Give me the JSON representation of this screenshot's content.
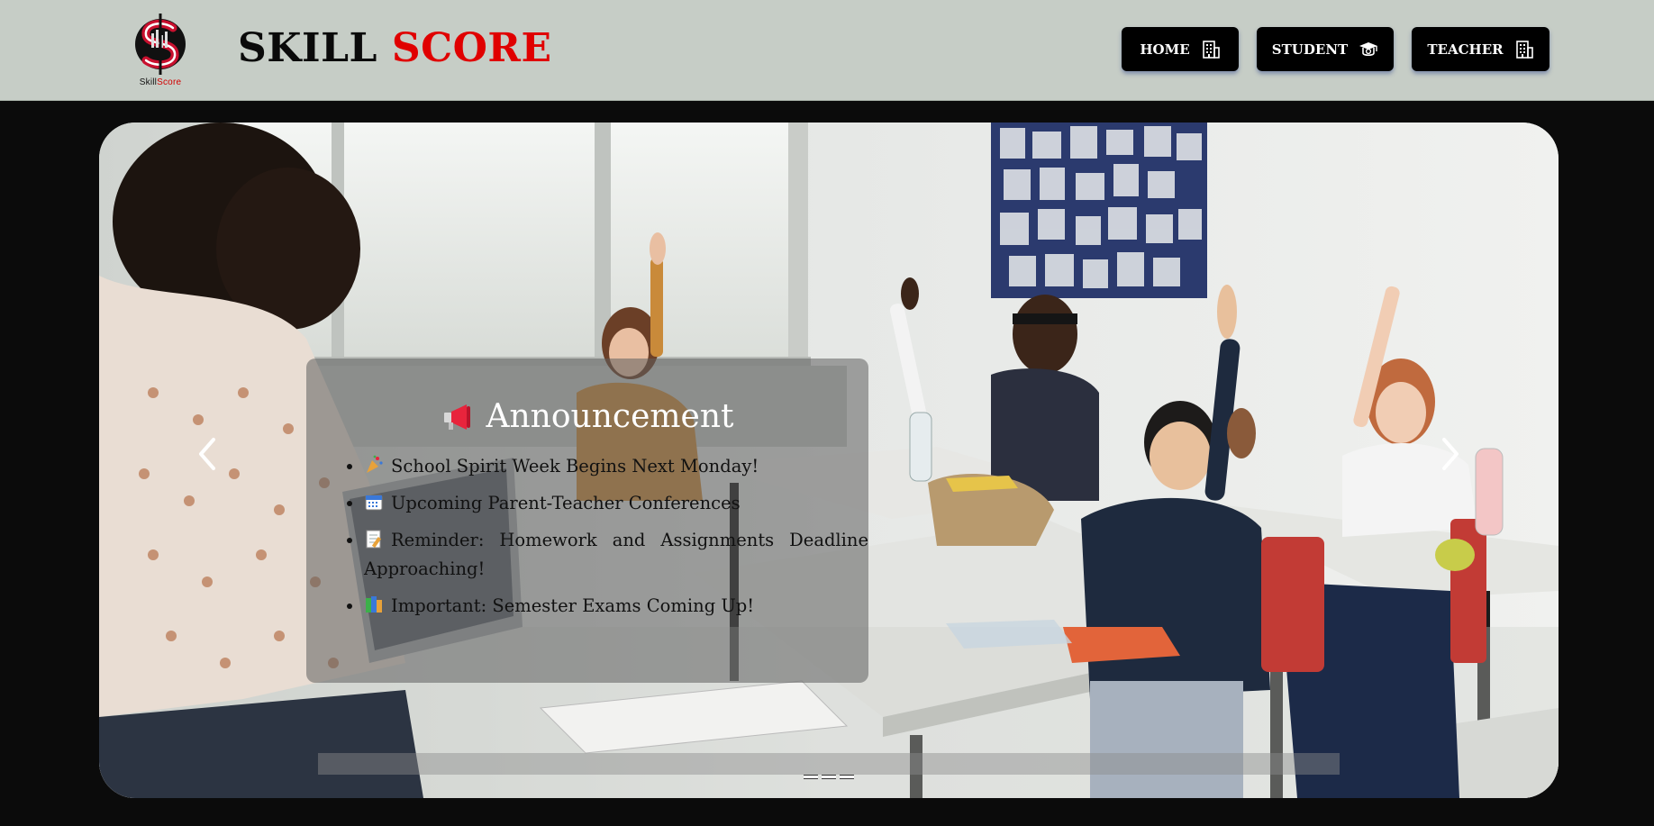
{
  "header": {
    "logo_text_a": "Skill",
    "logo_text_b": "Score",
    "brand_word_1": "SKILL",
    "brand_word_2": "SCORE",
    "brand_colors": {
      "dark": "#0a0a0a",
      "accent": "#e00000"
    },
    "nav": [
      {
        "label": "HOME",
        "icon": "building-icon"
      },
      {
        "label": "STUDENT",
        "icon": "graduation-cap-icon"
      },
      {
        "label": "TEACHER",
        "icon": "building-icon"
      }
    ]
  },
  "carousel": {
    "prev_icon": "chevron-left-icon",
    "next_icon": "chevron-right-icon",
    "announcement": {
      "title": "Announcement",
      "title_icon": "megaphone-icon",
      "items": [
        {
          "icon": "party-popper-icon",
          "text": "School Spirit Week Begins Next Monday!"
        },
        {
          "icon": "calendar-icon",
          "text": "Upcoming Parent-Teacher Conferences"
        },
        {
          "icon": "memo-icon",
          "text": "Reminder: Homework and Assignments Deadline Approaching!"
        },
        {
          "icon": "books-icon",
          "text": "Important: Semester Exams Coming Up!"
        }
      ]
    },
    "indicator_count": 3
  }
}
